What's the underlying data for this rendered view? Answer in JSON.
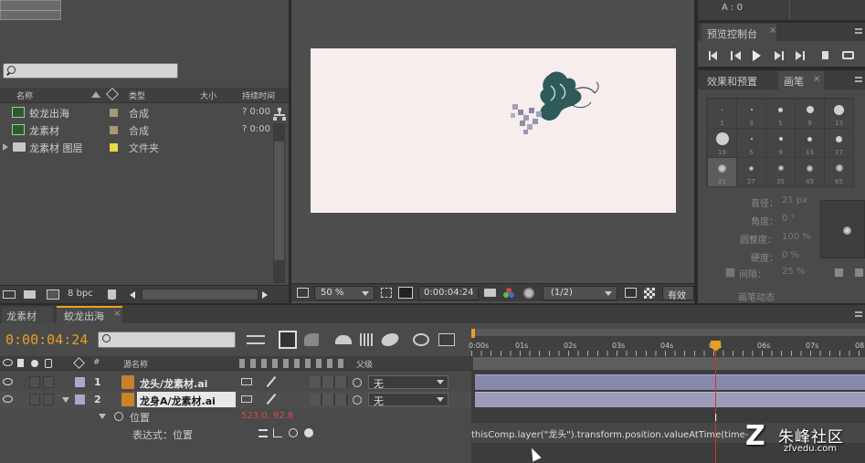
{
  "project": {
    "comp_info": "A : 0",
    "search_placeholder": "",
    "columns": [
      "名称",
      "类型",
      "大小",
      "持续时间"
    ],
    "items": [
      {
        "name": "蛟龙出海",
        "type": "合成",
        "duration": "? 0:00",
        "swatch": "#a89878"
      },
      {
        "name": "龙素材",
        "type": "合成",
        "duration": "? 0:00",
        "swatch": "#a89878"
      },
      {
        "name": "龙素材 图层",
        "type": "文件夹",
        "duration": "",
        "swatch": "#e6d84a"
      }
    ],
    "bpc": "8 bpc"
  },
  "viewer": {
    "zoom": "50 %",
    "timecode": "0:00:04:24",
    "resolution": "(1/2)",
    "more": "有效",
    "canvas_color": "#f7eded"
  },
  "preview": {
    "tab": "预览控制台"
  },
  "effects_tab": "效果和预置",
  "brush_tab": "画笔",
  "brushes": [
    {
      "size": 1,
      "dot": 1
    },
    {
      "size": 3,
      "dot": 2
    },
    {
      "size": 5,
      "dot": 5
    },
    {
      "size": 9,
      "dot": 8
    },
    {
      "size": 13,
      "dot": 11
    },
    {
      "size": 19,
      "dot": 14
    },
    {
      "size": 5,
      "dot": 2
    },
    {
      "size": 9,
      "dot": 4
    },
    {
      "size": 13,
      "dot": 5
    },
    {
      "size": 17,
      "dot": 7
    },
    {
      "size": 21,
      "dot": 9
    },
    {
      "size": 27,
      "dot": 5
    },
    {
      "size": 35,
      "dot": 6
    },
    {
      "size": 45,
      "dot": 7
    },
    {
      "size": 65,
      "dot": 8
    }
  ],
  "brush_props": {
    "diameter_label": "直径：",
    "diameter": "21 px",
    "angle_label": "角度：",
    "angle": "0 °",
    "roundness_label": "圆整度：",
    "roundness": "100 %",
    "hardness_label": "硬度：",
    "hardness": "0 %",
    "spacing_label": "间隔：",
    "spacing": "25 %",
    "dynamics": "画笔动态"
  },
  "timeline": {
    "tabs": [
      "龙素材",
      "蛟龙出海"
    ],
    "current_time": "0:00:04:24",
    "search_placeholder": "",
    "col_num": "#",
    "col_name": "源名称",
    "col_parent": "父级",
    "ruler": [
      "0:00s",
      "01s",
      "02s",
      "03s",
      "04s",
      "05s",
      "06s",
      "07s",
      "08"
    ],
    "layers": [
      {
        "num": "1",
        "name": "龙头/龙素材.ai",
        "parent": "无",
        "color": "#a8a8cc"
      },
      {
        "num": "2",
        "name": "龙身A/龙素材.ai",
        "parent": "无",
        "color": "#a8a8cc"
      }
    ],
    "position_label": "位置",
    "position_value": "523.0, 92.8",
    "expression_label": "表达式：位置",
    "expression_text": "thisComp.layer(\"龙头\").transform.position.valueAtTime(time-"
  },
  "watermark": {
    "brand": "朱峰社区",
    "url": "zfvedu.com"
  },
  "colors": {
    "accent_orange": "#e8a020",
    "playhead": "#d83030",
    "value_red": "#d84a4a"
  }
}
